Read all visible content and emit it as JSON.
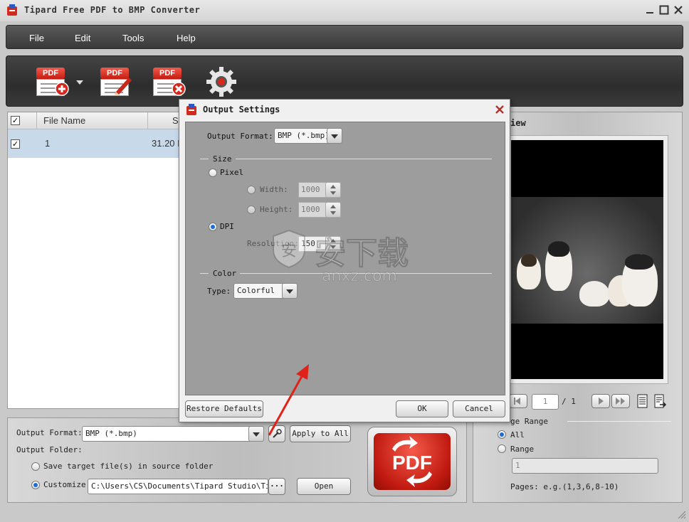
{
  "app": {
    "title": "Tipard Free PDF to BMP Converter"
  },
  "menu": [
    "File",
    "Edit",
    "Tools",
    "Help"
  ],
  "toolbar": {
    "icons": [
      "add-pdf-icon",
      "edit-pdf-icon",
      "remove-pdf-icon",
      "settings-gear-icon"
    ],
    "pdf_label": "PDF"
  },
  "file_list": {
    "columns": [
      "File Name",
      "S"
    ],
    "rows": [
      {
        "checked": true,
        "name": "1",
        "size": "31.20 I"
      }
    ]
  },
  "bottom": {
    "output_format_label": "Output Format:",
    "output_format_value": "BMP (*.bmp)",
    "apply_to_all": "Apply to All",
    "output_folder_label": "Output Folder:",
    "save_in_source": "Save target file(s) in source folder",
    "customize_label": "Customize:",
    "customize_path": "C:\\Users\\CS\\Documents\\Tipard Studio\\Tipar",
    "browse_label": "···",
    "open_label": "Open",
    "convert_label": "PDF"
  },
  "preview": {
    "title": "iew",
    "page_value": "1",
    "page_total": "/ 1",
    "range_title": "ge Range",
    "all_label": "All",
    "range_label": "Range",
    "range_value": "1",
    "pages_hint": "Pages: e.g.(1,3,6,8-10)"
  },
  "dialog": {
    "title": "Output Settings",
    "output_format_label": "Output Format:",
    "output_format_value": "BMP (*.bmp)",
    "size_section": "Size",
    "pixel_label": "Pixel",
    "width_label": "Width:",
    "width_value": "1000",
    "height_label": "Height:",
    "height_value": "1000",
    "dpi_label": "DPI",
    "resolution_label": "Resolution:",
    "resolution_value": "150",
    "color_section": "Color",
    "type_label": "Type:",
    "type_value": "Colorful",
    "restore_defaults": "Restore Defaults",
    "ok": "OK",
    "cancel": "Cancel"
  },
  "watermark": {
    "text": "安下载",
    "subtext": "anxz.com"
  },
  "colors": {
    "accent_red": "#d0261a",
    "radio_blue": "#1a6fd6",
    "selection": "#c8d9ea"
  }
}
